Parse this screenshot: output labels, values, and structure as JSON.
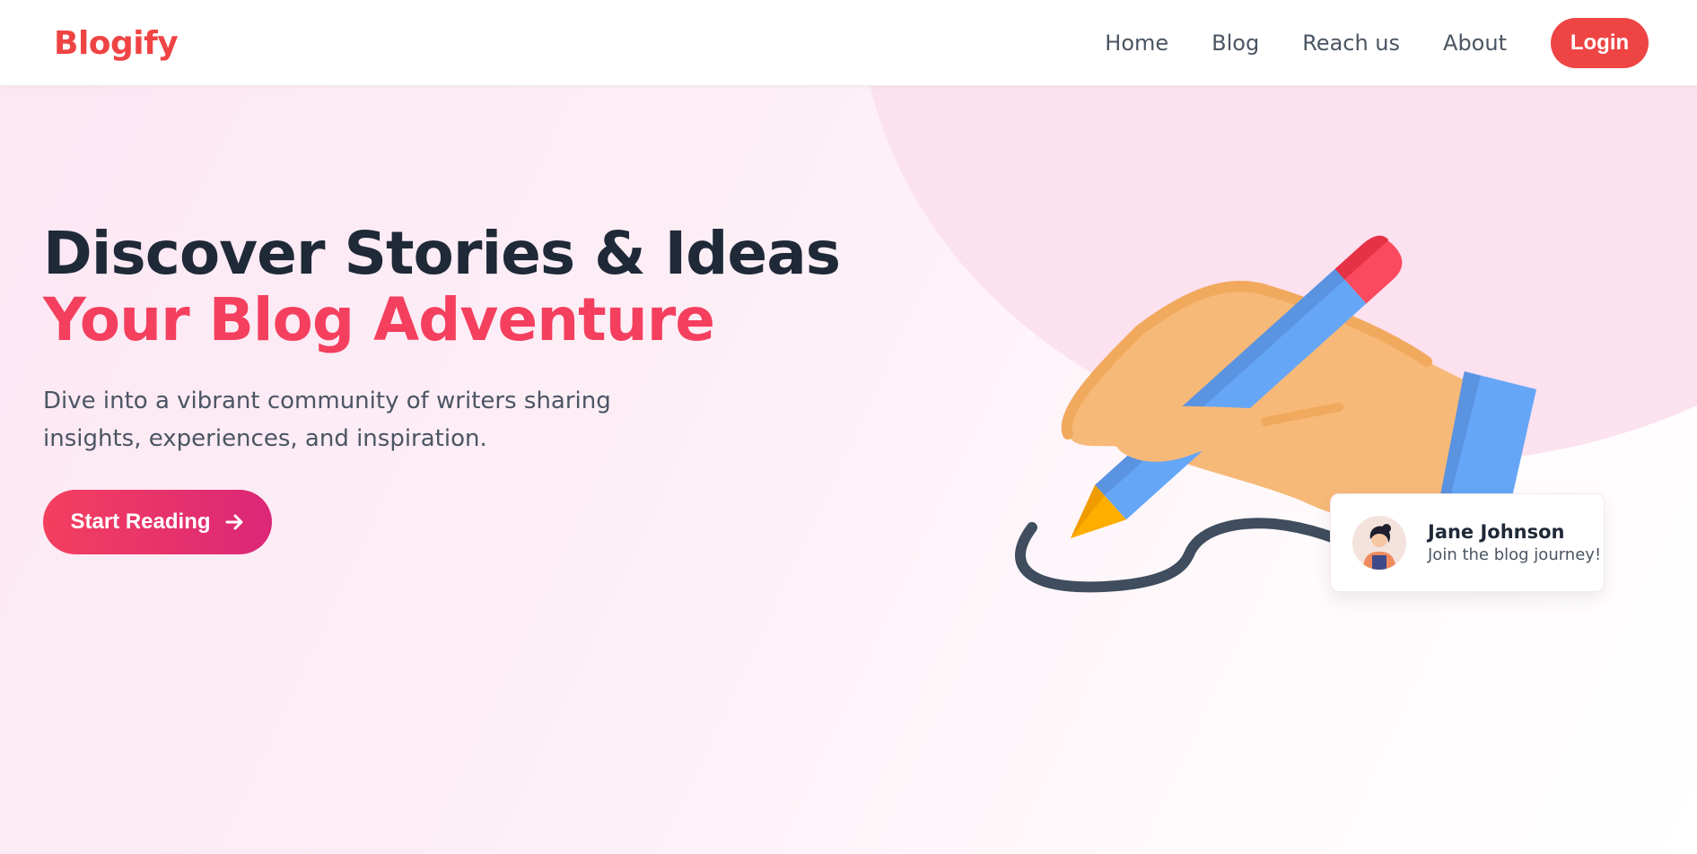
{
  "header": {
    "brand": "Blogify",
    "nav": [
      {
        "label": "Home"
      },
      {
        "label": "Blog"
      },
      {
        "label": "Reach us"
      },
      {
        "label": "About"
      }
    ],
    "login_label": "Login"
  },
  "hero": {
    "title_line1": "Discover Stories & Ideas",
    "title_line2": "Your Blog Adventure",
    "description": "Dive into a vibrant community of writers sharing insights, experiences, and inspiration.",
    "cta_label": "Start Reading",
    "cta_icon": "arrow-right-icon",
    "illustration": "hand-writing-with-pencil"
  },
  "profile_card": {
    "name": "Jane Johnson",
    "subtitle": "Join the blog journey!",
    "avatar_icon": "woman-avatar"
  },
  "colors": {
    "brand": "#ef4444",
    "accent": "#f43f5e",
    "heading": "#1f2937",
    "body_text": "#4b5563",
    "cta_gradient_start": "#f43f5e",
    "cta_gradient_end": "#db2777",
    "hero_background": "#fce7f3"
  }
}
